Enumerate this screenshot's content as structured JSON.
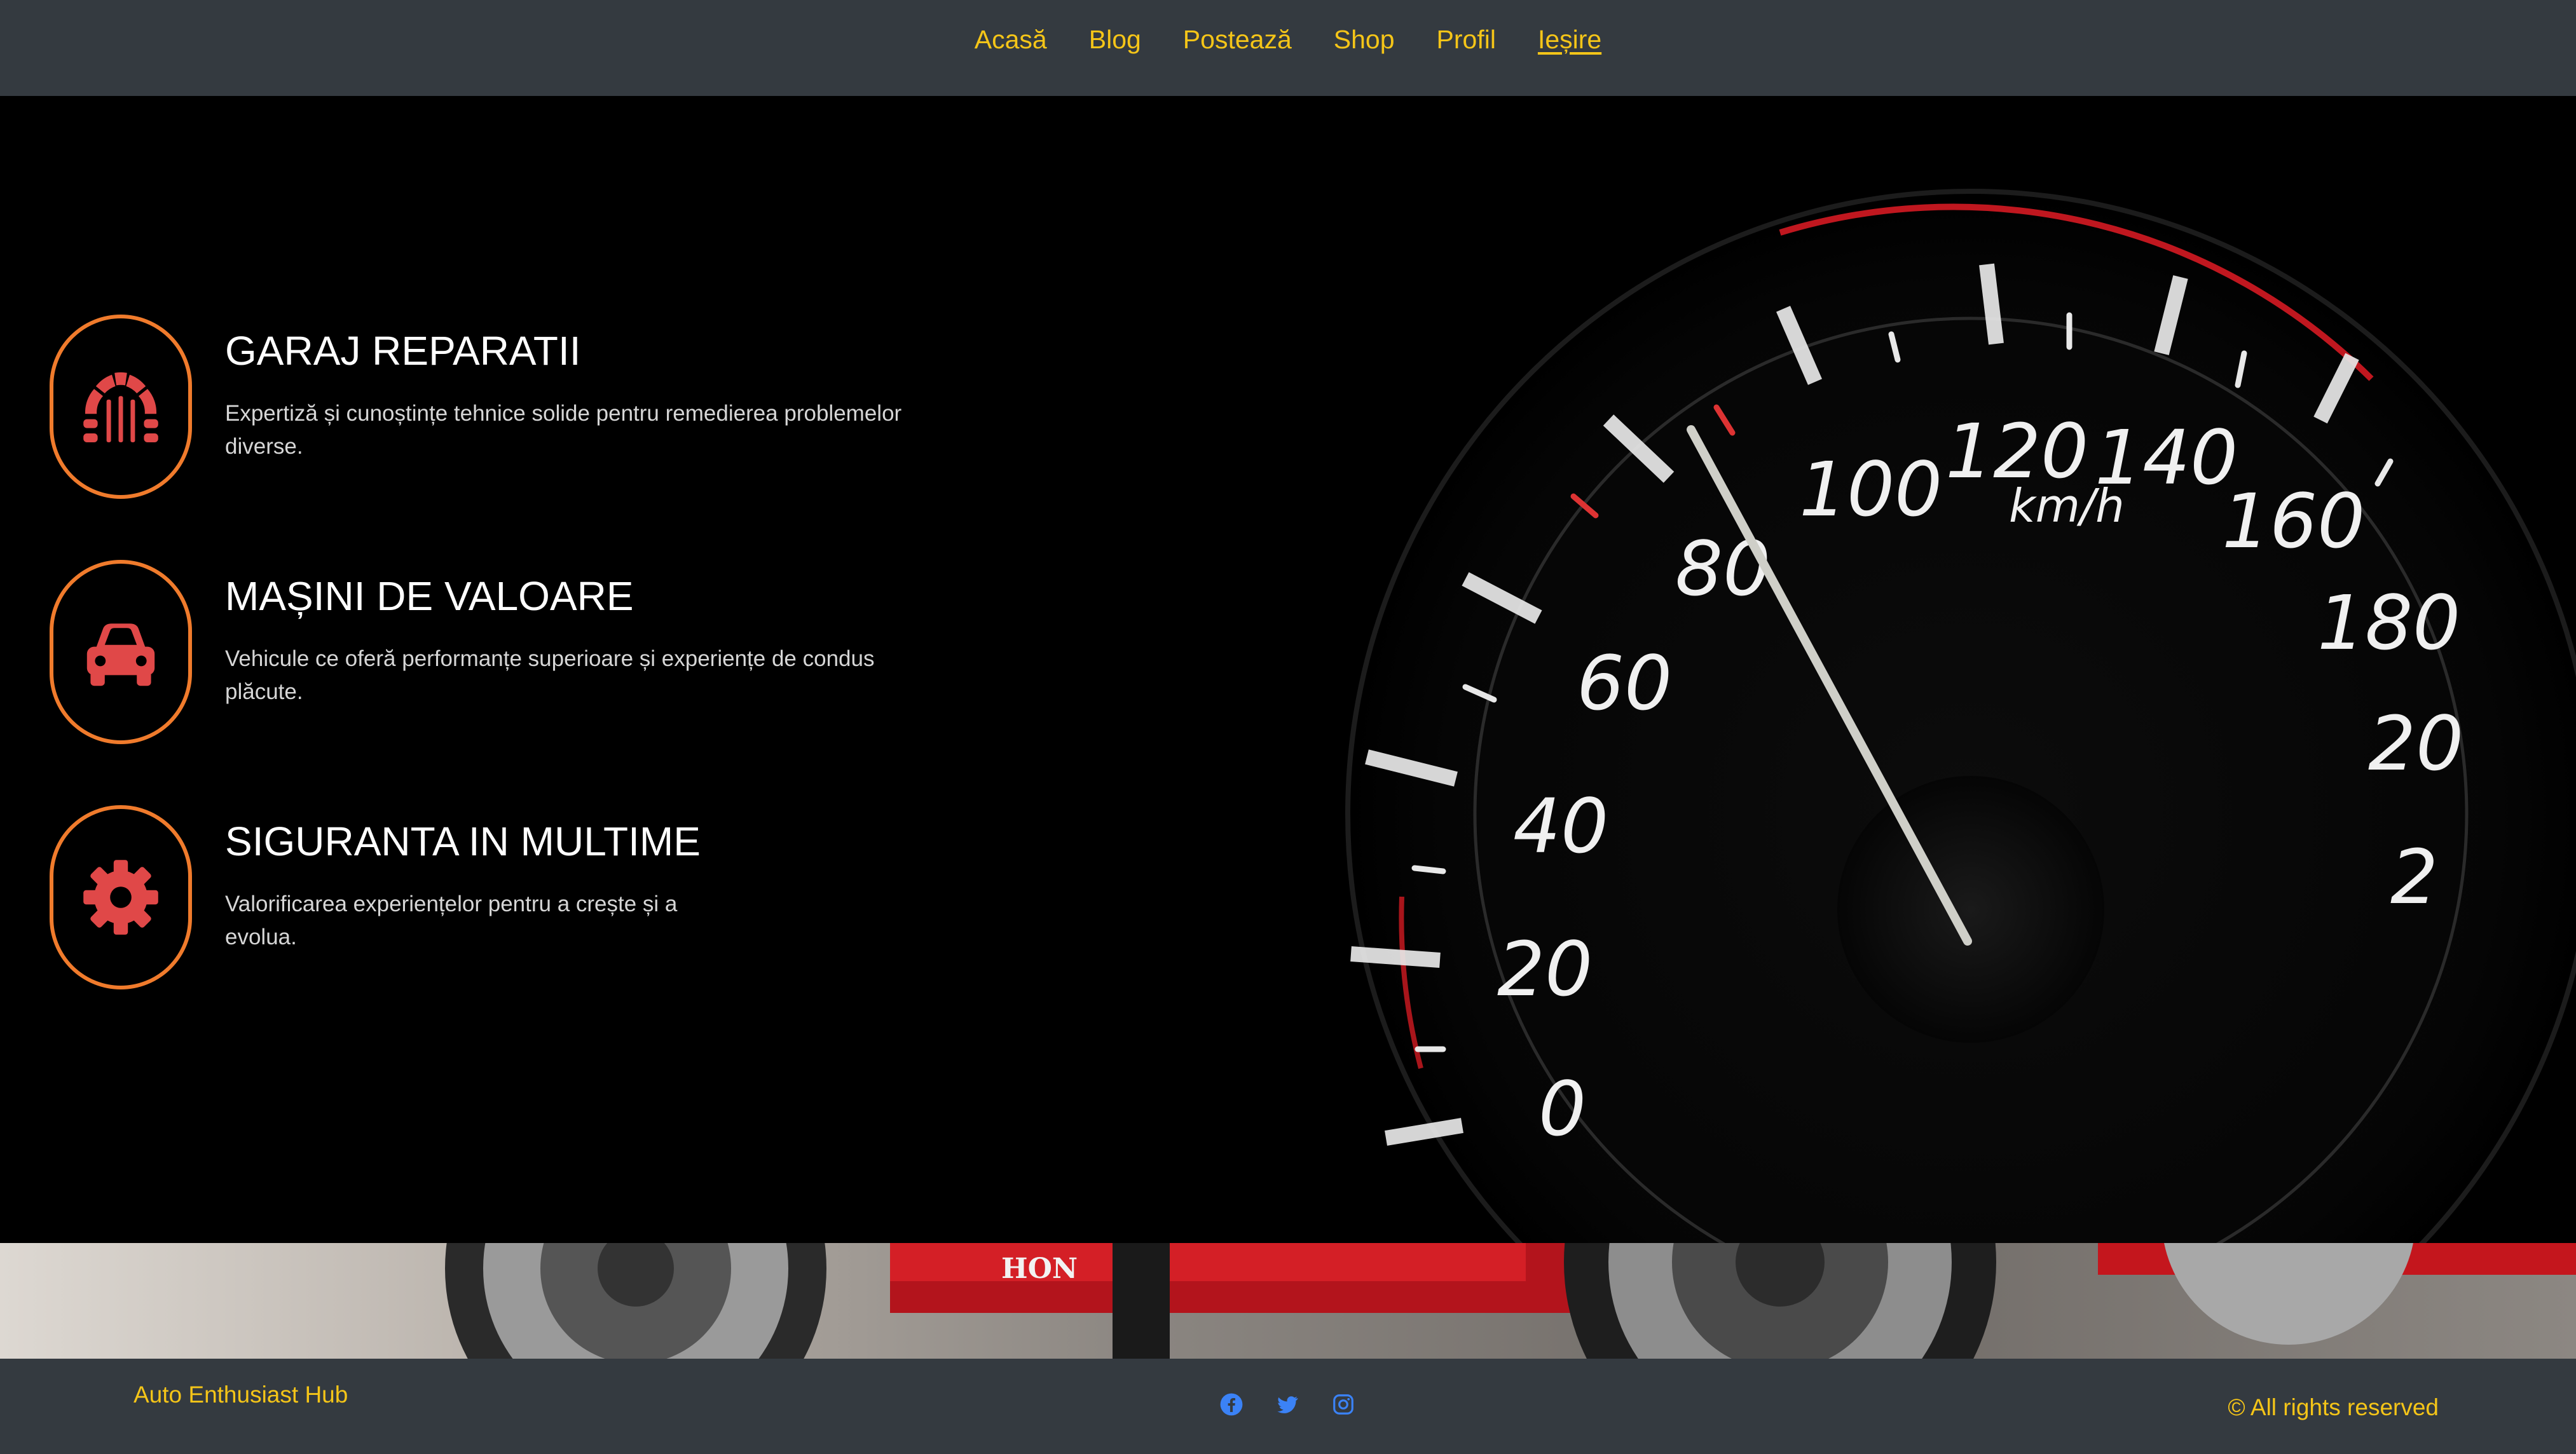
{
  "nav": {
    "items": [
      {
        "label": "Acasă"
      },
      {
        "label": "Blog"
      },
      {
        "label": "Postează"
      },
      {
        "label": "Shop"
      },
      {
        "label": "Profil"
      },
      {
        "label": "Ieșire"
      }
    ]
  },
  "features": [
    {
      "icon": "garage-icon",
      "title": "GARAJ REPARATII",
      "description": "Expertiză și cunoștințe tehnice solide pentru remedierea problemelor diverse."
    },
    {
      "icon": "car-icon",
      "title": "MAȘINI DE VALOARE",
      "description": "Vehicule ce oferă performanțe superioare și experiențe de condus plăcute."
    },
    {
      "icon": "gear-icon",
      "title": "SIGURANTA IN MULTIME",
      "description": "Valorificarea experiențelor pentru a crește și a evolua."
    }
  ],
  "gauge": {
    "labels": [
      "0",
      "20",
      "40",
      "60",
      "80",
      "100",
      "120",
      "140",
      "160",
      "180",
      "20",
      "2"
    ],
    "unit": "km/h"
  },
  "bike": {
    "brand_text": "HON"
  },
  "footer": {
    "brand": "Auto Enthusiast Hub",
    "social": [
      "facebook-icon",
      "twitter-icon",
      "instagram-icon"
    ],
    "copyright": "© All rights reserved"
  },
  "colors": {
    "navbar_bg": "#343a40",
    "nav_text": "#f5c518",
    "accent_border": "#f07b2c",
    "icon_red": "#e04848",
    "social_blue": "#3b82f6"
  }
}
